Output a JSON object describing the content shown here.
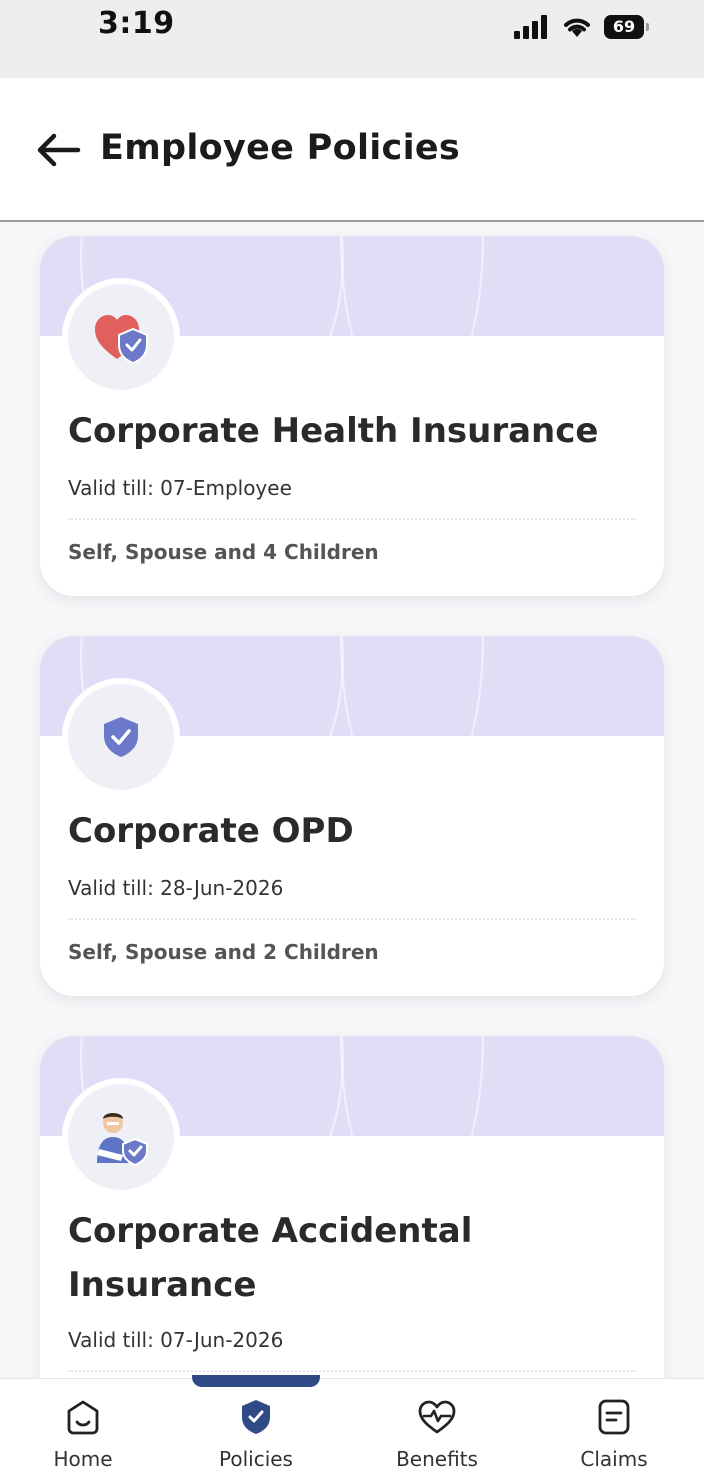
{
  "status_bar": {
    "time": "3:19",
    "battery": "69"
  },
  "header": {
    "title": "Employee Policies"
  },
  "policies": [
    {
      "title": "Corporate Health Insurance",
      "valid": "Valid till: 07-Employee",
      "coverage": "Self, Spouse and 4 Children",
      "icon": "heart-shield-icon"
    },
    {
      "title": "Corporate OPD",
      "valid": "Valid till: 28-Jun-2026",
      "coverage": "Self, Spouse and 2 Children",
      "icon": "shield-check-icon"
    },
    {
      "title": "Corporate Accidental Insurance",
      "valid": "Valid till: 07-Jun-2026",
      "coverage": "",
      "icon": "injured-person-icon"
    }
  ],
  "nav": {
    "items": [
      {
        "label": "Home",
        "icon": "home-icon"
      },
      {
        "label": "Policies",
        "icon": "shield-icon"
      },
      {
        "label": "Benefits",
        "icon": "heart-pulse-icon"
      },
      {
        "label": "Claims",
        "icon": "document-icon"
      }
    ],
    "active": "Policies"
  },
  "colors": {
    "banner": "#e2dcf6",
    "accent": "#2f4a84",
    "shield": "#6c79c9",
    "heart": "#e0605e"
  }
}
